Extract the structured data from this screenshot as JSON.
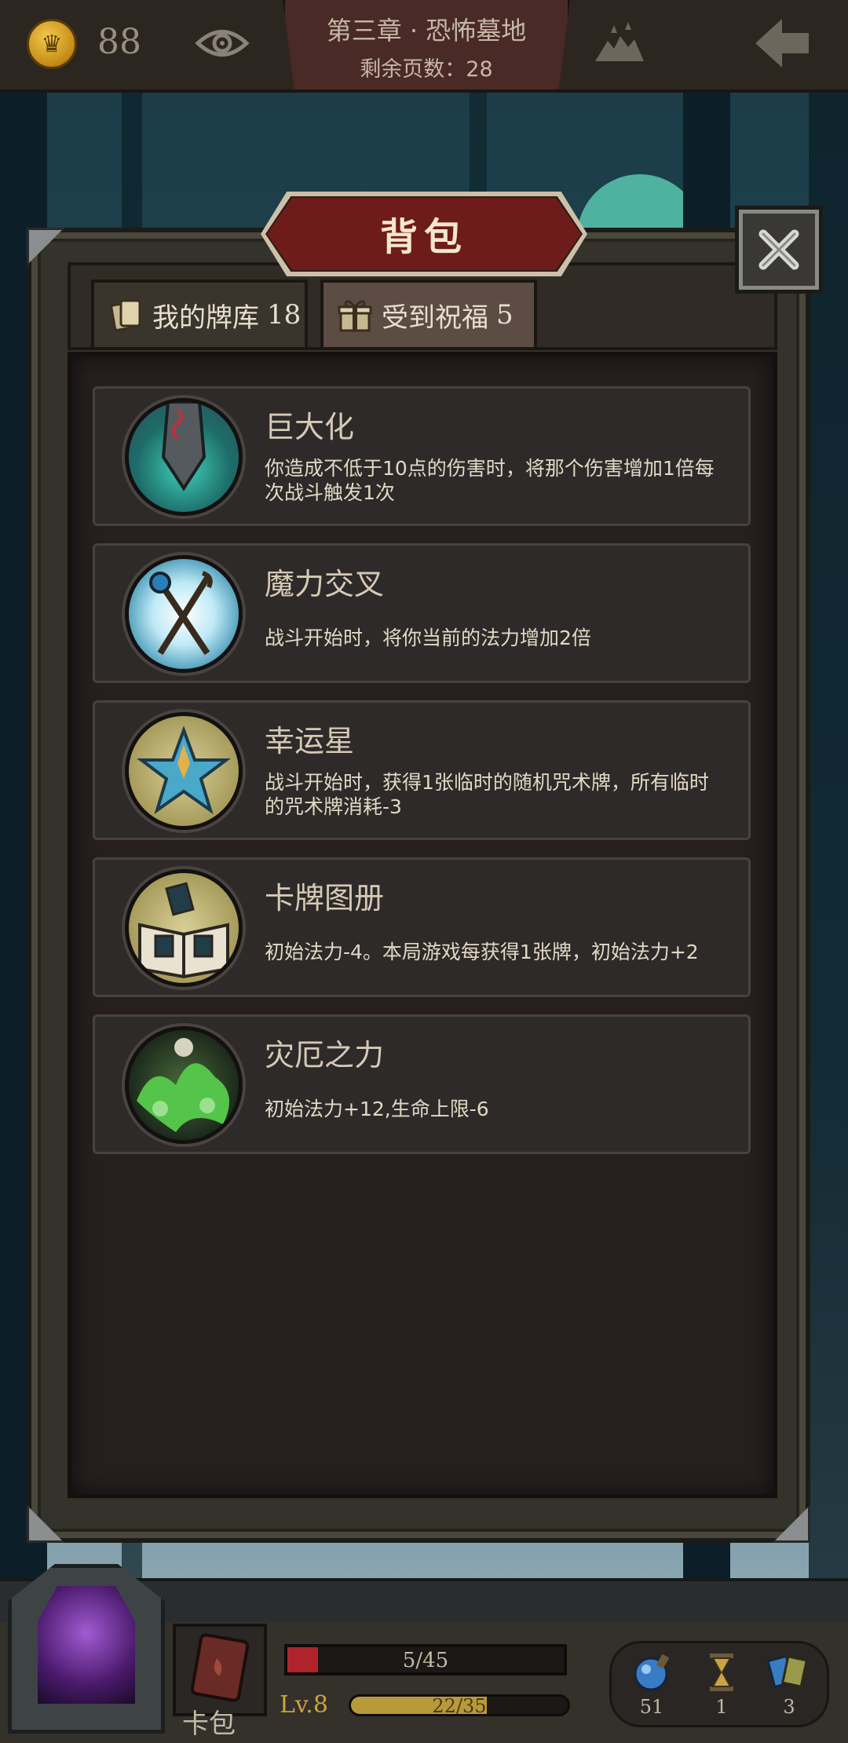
{
  "top_bar": {
    "coins": "88",
    "chapter_title": "第三章 · 恐怖墓地",
    "pages_remaining": "剩余页数：28"
  },
  "panel": {
    "title": "背包",
    "tabs": [
      {
        "label": "我的牌库",
        "count": "18"
      },
      {
        "label": "受到祝福",
        "count": "5"
      }
    ],
    "active_tab": 1,
    "blessings": [
      {
        "name": "巨大化",
        "desc": "你造成不低于10点的伤害时，将那个伤害增加1倍每次战斗触发1次",
        "icon": "giant-sword-icon"
      },
      {
        "name": "魔力交叉",
        "desc": "战斗开始时，将你当前的法力增加2倍",
        "icon": "crossed-staffs-icon"
      },
      {
        "name": "幸运星",
        "desc": "战斗开始时，获得1张临时的随机咒术牌，所有临时的咒术牌消耗-3",
        "icon": "star-icon"
      },
      {
        "name": "卡牌图册",
        "desc": "初始法力-4。本局游戏每获得1张牌，初始法力+2",
        "icon": "card-book-icon"
      },
      {
        "name": "灾厄之力",
        "desc": "初始法力+12,生命上限-6",
        "icon": "calamity-skull-icon"
      }
    ]
  },
  "hud": {
    "bag_label": "卡包",
    "hp": {
      "current": 5,
      "max": 45,
      "text": "5/45"
    },
    "level": "Lv.8",
    "xp": {
      "current": 22,
      "max": 35,
      "text": "22/35"
    },
    "resources": [
      {
        "name": "potion",
        "value": "51",
        "icon": "blue-orb-icon"
      },
      {
        "name": "hourglass",
        "value": "1",
        "icon": "hourglass-icon"
      },
      {
        "name": "cards",
        "value": "3",
        "icon": "cards-icon"
      }
    ]
  },
  "colors": {
    "banner_red": "#6e1b1b",
    "hp_red": "#b0232a",
    "xp_gold": "#b99a3a",
    "panel_dark": "#261e1f"
  }
}
